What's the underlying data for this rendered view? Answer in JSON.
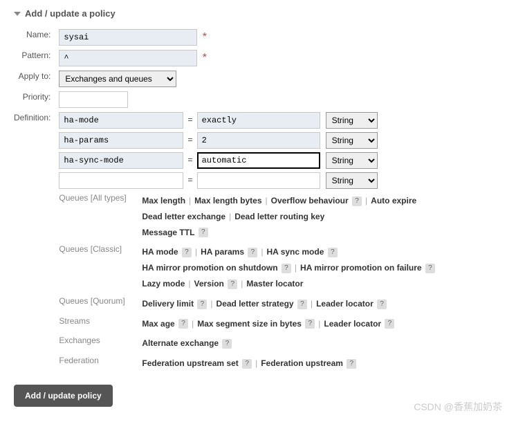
{
  "section": {
    "title": "Add / update a policy"
  },
  "labels": {
    "name": "Name:",
    "pattern": "Pattern:",
    "apply_to": "Apply to:",
    "priority": "Priority:",
    "definition": "Definition:"
  },
  "fields": {
    "name": "sysai",
    "pattern": "^",
    "apply_to_options": [
      "Exchanges and queues"
    ],
    "apply_to_selected": "Exchanges and queues",
    "priority": "",
    "type_options": [
      "String"
    ]
  },
  "definition_rows": [
    {
      "key": "ha-mode",
      "value": "exactly",
      "type": "String",
      "active": false,
      "key_bg": "blue",
      "val_bg": "blue"
    },
    {
      "key": "ha-params",
      "value": "2",
      "type": "String",
      "active": false,
      "key_bg": "blue",
      "val_bg": "blue"
    },
    {
      "key": "ha-sync-mode",
      "value": "automatic",
      "type": "String",
      "active": true,
      "key_bg": "blue",
      "val_bg": "white"
    },
    {
      "key": "",
      "value": "",
      "type": "String",
      "active": false,
      "key_bg": "white",
      "val_bg": "white"
    }
  ],
  "hint_groups": [
    {
      "label": "Queues [All types]",
      "items": [
        {
          "t": "Max length"
        },
        {
          "t": "Max length bytes"
        },
        {
          "t": "Overflow behaviour",
          "h": true
        },
        {
          "t": "Auto expire"
        },
        {
          "br": true
        },
        {
          "t": "Dead letter exchange"
        },
        {
          "t": "Dead letter routing key"
        },
        {
          "br": true
        },
        {
          "t": "Message TTL",
          "h": true
        }
      ]
    },
    {
      "label": "Queues [Classic]",
      "items": [
        {
          "t": "HA mode",
          "h": true
        },
        {
          "t": "HA params",
          "h": true
        },
        {
          "t": "HA sync mode",
          "h": true
        },
        {
          "br": true
        },
        {
          "t": "HA mirror promotion on shutdown",
          "h": true
        },
        {
          "t": "HA mirror promotion on failure",
          "h": true
        },
        {
          "br": true
        },
        {
          "t": "Lazy mode"
        },
        {
          "t": "Version",
          "h": true
        },
        {
          "t": "Master locator"
        }
      ]
    },
    {
      "label": "Queues [Quorum]",
      "items": [
        {
          "t": "Delivery limit",
          "h": true
        },
        {
          "t": "Dead letter strategy",
          "h": true
        },
        {
          "t": "Leader locator",
          "h": true
        }
      ]
    },
    {
      "label": "Streams",
      "items": [
        {
          "t": "Max age",
          "h": true
        },
        {
          "t": "Max segment size in bytes",
          "h": true
        },
        {
          "t": "Leader locator",
          "h": true
        }
      ]
    },
    {
      "label": "Exchanges",
      "items": [
        {
          "t": "Alternate exchange",
          "h": true
        }
      ]
    },
    {
      "label": "Federation",
      "items": [
        {
          "t": "Federation upstream set",
          "h": true
        },
        {
          "t": "Federation upstream",
          "h": true
        }
      ]
    }
  ],
  "submit": "Add / update policy",
  "watermark": "CSDN @香蕉加奶茶"
}
